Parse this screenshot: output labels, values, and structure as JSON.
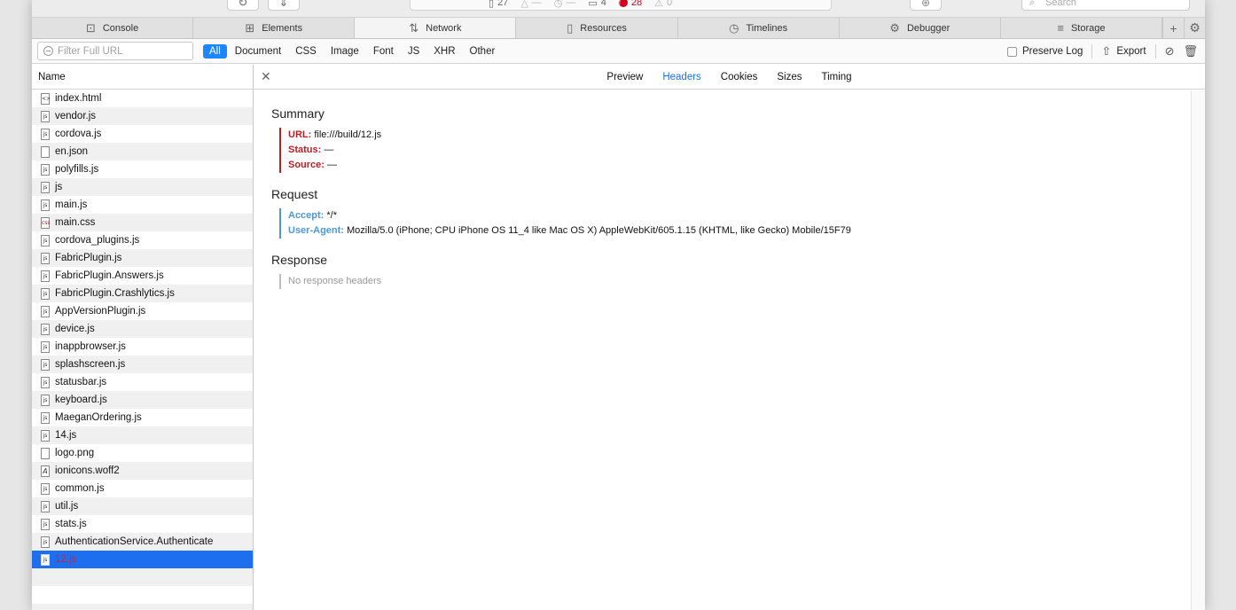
{
  "toolbar": {
    "pages_count": "27",
    "dash1": "—",
    "dash2": "—",
    "logs_count": "4",
    "errors_count": "28",
    "warnings_count": "0",
    "search_placeholder": "Search"
  },
  "tabs": [
    {
      "label": "Console",
      "icon": "console-icon"
    },
    {
      "label": "Elements",
      "icon": "elements-icon"
    },
    {
      "label": "Network",
      "icon": "network-icon",
      "active": true
    },
    {
      "label": "Resources",
      "icon": "resources-icon"
    },
    {
      "label": "Timelines",
      "icon": "timelines-icon"
    },
    {
      "label": "Debugger",
      "icon": "debugger-icon"
    },
    {
      "label": "Storage",
      "icon": "storage-icon"
    }
  ],
  "filter": {
    "placeholder": "Filter Full URL",
    "types": [
      "All",
      "Document",
      "CSS",
      "Image",
      "Font",
      "JS",
      "XHR",
      "Other"
    ],
    "selected_type": "All",
    "preserve_log": "Preserve Log",
    "export": "Export"
  },
  "sidebar": {
    "header": "Name",
    "files": [
      {
        "name": "index.html",
        "type": "html"
      },
      {
        "name": "vendor.js",
        "type": "js"
      },
      {
        "name": "cordova.js",
        "type": "js"
      },
      {
        "name": "en.json",
        "type": "other"
      },
      {
        "name": "polyfills.js",
        "type": "js"
      },
      {
        "name": "js",
        "type": "js"
      },
      {
        "name": "main.js",
        "type": "js"
      },
      {
        "name": "main.css",
        "type": "css"
      },
      {
        "name": "cordova_plugins.js",
        "type": "js"
      },
      {
        "name": "FabricPlugin.js",
        "type": "js"
      },
      {
        "name": "FabricPlugin.Answers.js",
        "type": "js"
      },
      {
        "name": "FabricPlugin.Crashlytics.js",
        "type": "js"
      },
      {
        "name": "AppVersionPlugin.js",
        "type": "js"
      },
      {
        "name": "device.js",
        "type": "js"
      },
      {
        "name": "inappbrowser.js",
        "type": "js"
      },
      {
        "name": "splashscreen.js",
        "type": "js"
      },
      {
        "name": "statusbar.js",
        "type": "js"
      },
      {
        "name": "keyboard.js",
        "type": "js"
      },
      {
        "name": "MaeganOrdering.js",
        "type": "js"
      },
      {
        "name": "14.js",
        "type": "js"
      },
      {
        "name": "logo.png",
        "type": "image"
      },
      {
        "name": "ionicons.woff2",
        "type": "font"
      },
      {
        "name": "common.js",
        "type": "js"
      },
      {
        "name": "util.js",
        "type": "js"
      },
      {
        "name": "stats.js",
        "type": "js"
      },
      {
        "name": "AuthenticationService.Authenticate",
        "type": "js"
      },
      {
        "name": "12.js",
        "type": "js",
        "selected": true
      }
    ]
  },
  "detail": {
    "tabs": [
      "Preview",
      "Headers",
      "Cookies",
      "Sizes",
      "Timing"
    ],
    "selected_tab": "Headers",
    "summary": {
      "title": "Summary",
      "rows": [
        {
          "key": "URL:",
          "value": "file:///build/12.js"
        },
        {
          "key": "Status:",
          "value": "—"
        },
        {
          "key": "Source:",
          "value": "—"
        }
      ]
    },
    "request": {
      "title": "Request",
      "rows": [
        {
          "key": "Accept:",
          "value": "*/*"
        },
        {
          "key": "User-Agent:",
          "value": "Mozilla/5.0 (iPhone; CPU iPhone OS 11_4 like Mac OS X) AppleWebKit/605.1.15 (KHTML, like Gecko) Mobile/15F79"
        }
      ]
    },
    "response": {
      "title": "Response",
      "note": "No response headers"
    }
  },
  "colors": {
    "accent": "#1e86ff",
    "selection": "#1e6ff0",
    "error": "#d0021b",
    "summary_key": "#b81e28",
    "request_key": "#4f96d4"
  }
}
